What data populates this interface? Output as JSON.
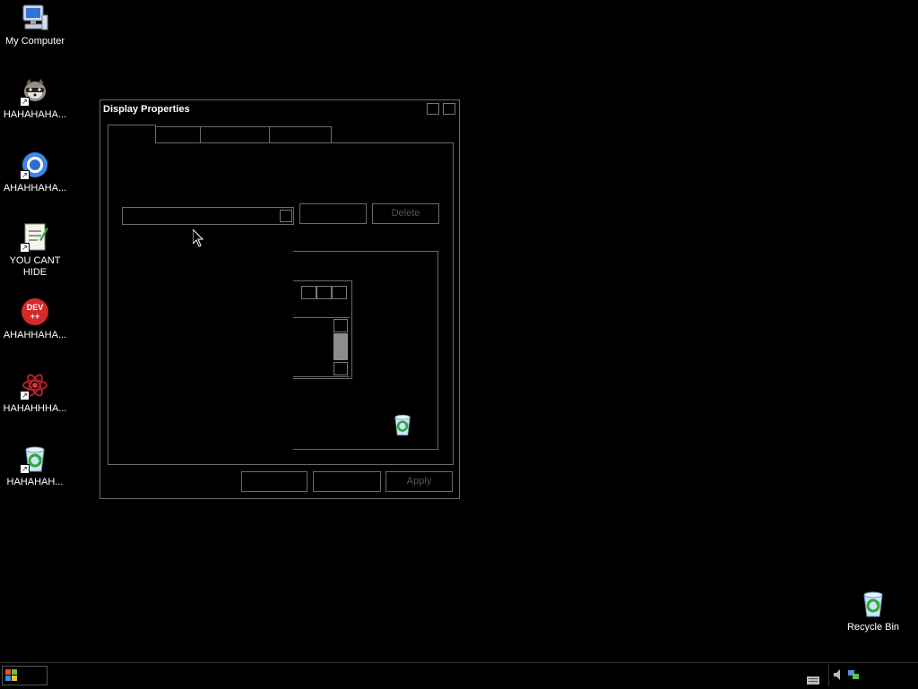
{
  "desktop": {
    "icons": [
      {
        "label": "My Computer",
        "icon": "my-computer-icon"
      },
      {
        "label": "HAHAHAHA...",
        "icon": "raccoon-icon"
      },
      {
        "label": "AHAHHAHA...",
        "icon": "chrome-icon"
      },
      {
        "label": "YOU CANT HIDE",
        "icon": "notepad-document-icon"
      },
      {
        "label": "AHAHHAHA...",
        "icon": "dev-cpp-icon"
      },
      {
        "label": "HAHAHHHA...",
        "icon": "red-atom-icon"
      },
      {
        "label": "HAHAHAH...",
        "icon": "recycle-bin-icon"
      }
    ],
    "recycle_bin": {
      "label": "Recycle Bin"
    }
  },
  "window": {
    "title": "Display Properties",
    "buttons": {
      "delete": "Delete",
      "apply": "Apply",
      "ok": "",
      "cancel": ""
    }
  },
  "colors": {
    "background": "#000000",
    "border": "#6a6a6a",
    "text": "#ffffff",
    "disabled_text": "#555555"
  }
}
